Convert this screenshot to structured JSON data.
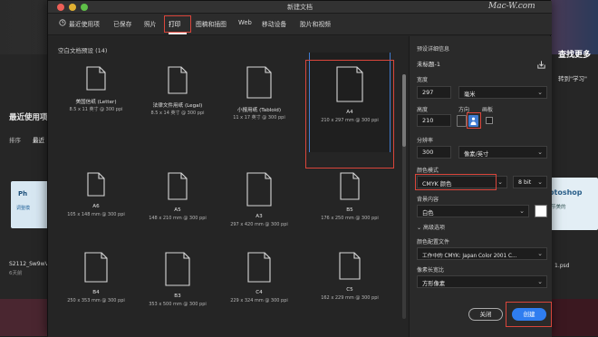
{
  "background": {
    "recent_title": "最近使用项",
    "sort_label": "排序",
    "sort_value": "最近",
    "right_heading": "查找更多",
    "right_sub": "转到\"学习\"",
    "left_thumb_brand": "Ph",
    "left_thumb_sub": "调整模",
    "left_file_name": "S2112_Sw9wV",
    "left_file_date": "6天前",
    "right_thumb_brand": "otoshop",
    "right_thumb_sub": "节美的",
    "right_file_name": "1.psd"
  },
  "dialog": {
    "title": "新建文档",
    "watermark": "Mac-W.com",
    "tabs": [
      {
        "label": "最近使用项",
        "icon": "clock-icon"
      },
      {
        "label": "已保存"
      },
      {
        "label": "照片"
      },
      {
        "label": "打印",
        "active": true
      },
      {
        "label": "图稿和插图"
      },
      {
        "label": "Web"
      },
      {
        "label": "移动设备"
      },
      {
        "label": "胶片和视频"
      }
    ],
    "section_label": "空白文档预设",
    "section_count": "(14)",
    "presets": [
      {
        "name": "美国信纸 (Letter)",
        "size": "8.5 x 11 英寸 @ 300 ppi"
      },
      {
        "name": "法律文件用纸 (Legal)",
        "size": "8.5 x 14 英寸 @ 300 ppi"
      },
      {
        "name": "小报用纸 (Tabloid)",
        "size": "11 x 17 英寸 @ 300 ppi"
      },
      {
        "name": "A4",
        "size": "210 x 297 mm @ 300 ppi",
        "selected": true
      },
      {
        "name": "A6",
        "size": "105 x 148 mm @ 300 ppi"
      },
      {
        "name": "A5",
        "size": "148 x 210 mm @ 300 ppi"
      },
      {
        "name": "A3",
        "size": "297 x 420 mm @ 300 ppi"
      },
      {
        "name": "B5",
        "size": "176 x 250 mm @ 300 ppi"
      },
      {
        "name": "B4",
        "size": "250 x 353 mm @ 300 ppi"
      },
      {
        "name": "B3",
        "size": "353 x 500 mm @ 300 ppi"
      },
      {
        "name": "C4",
        "size": "229 x 324 mm @ 300 ppi"
      },
      {
        "name": "C5",
        "size": "162 x 229 mm @ 300 ppi"
      }
    ],
    "details": {
      "header": "预设详细信息",
      "doc_name": "未标题-1",
      "width_label": "宽度",
      "width_value": "297",
      "width_unit": "毫米",
      "height_label": "高度",
      "height_value": "210",
      "orientation_label": "方向",
      "artboard_label": "画板",
      "resolution_label": "分辨率",
      "resolution_value": "300",
      "resolution_unit": "像素/英寸",
      "color_mode_label": "颜色模式",
      "color_mode_value": "CMYK 颜色",
      "bit_depth": "8 bit",
      "bg_label": "背景内容",
      "bg_value": "白色",
      "advanced_label": "高级选项",
      "profile_label": "颜色配置文件",
      "profile_value": "工作中的 CMYK: Japan Color 2001 C...",
      "pixel_ratio_label": "像素长宽比",
      "pixel_ratio_value": "方形像素",
      "close_label": "关闭",
      "create_label": "创建"
    }
  },
  "colors": {
    "accent": "#2f7df0",
    "highlight_outline": "#d9453b"
  }
}
